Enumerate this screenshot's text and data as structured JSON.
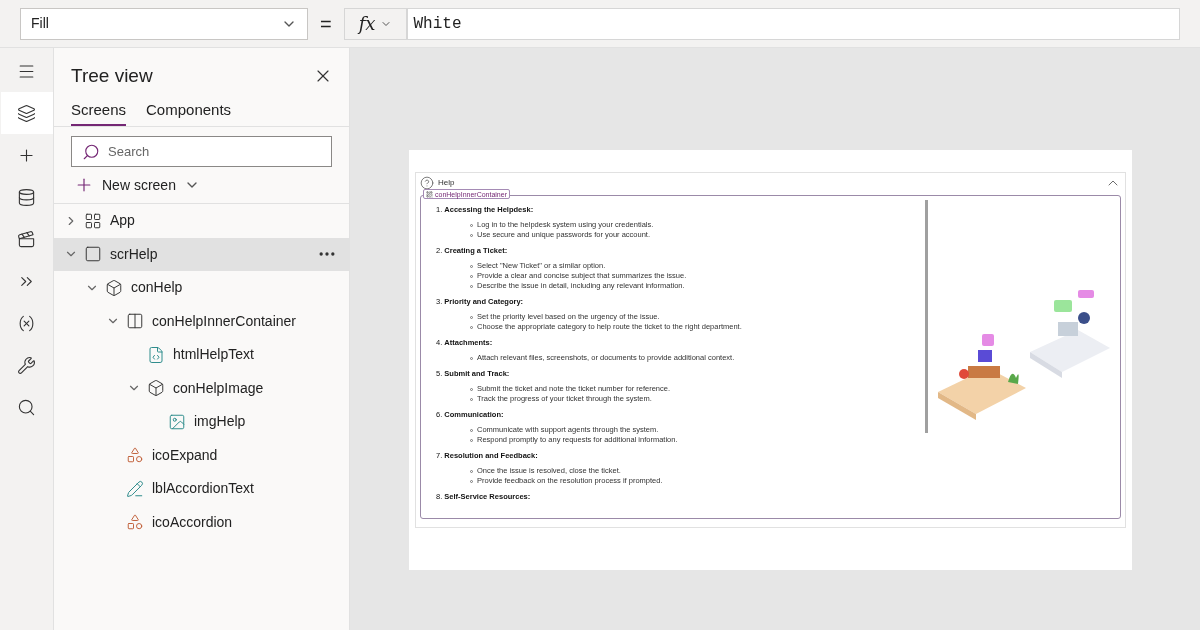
{
  "formula_bar": {
    "property": "Fill",
    "operator": "=",
    "fx_label": "fx",
    "value": "White"
  },
  "rail": [
    {
      "selected": false
    },
    {
      "selected": true
    },
    {
      "selected": false
    },
    {
      "selected": false
    },
    {
      "selected": false
    },
    {
      "selected": false
    },
    {
      "selected": false
    },
    {
      "selected": false
    },
    {
      "selected": false
    }
  ],
  "tree_view": {
    "title": "Tree view",
    "tabs": [
      {
        "label": "Screens",
        "selected": true
      },
      {
        "label": "Components",
        "selected": false
      }
    ],
    "search": {
      "placeholder": "Search"
    },
    "new_screen": "New screen",
    "items": [
      {
        "label": "App",
        "kind": "app",
        "expanded": false,
        "selected": false
      },
      {
        "label": "scrHelp",
        "kind": "screen",
        "expanded": true,
        "selected": true,
        "children": [
          {
            "label": "conHelp",
            "kind": "container",
            "expanded": true,
            "selected": false,
            "children": [
              {
                "label": "conHelpInnerContainer",
                "kind": "columns",
                "expanded": true,
                "selected": false,
                "children": [
                  {
                    "label": "htmlHelpText",
                    "kind": "html",
                    "selected": false
                  },
                  {
                    "label": "conHelpImage",
                    "kind": "container",
                    "expanded": true,
                    "selected": false,
                    "children": [
                      {
                        "label": "imgHelp",
                        "kind": "image",
                        "selected": false
                      }
                    ]
                  }
                ]
              },
              {
                "label": "icoExpand",
                "kind": "icon",
                "selected": false
              },
              {
                "label": "lblAccordionText",
                "kind": "label",
                "selected": false
              },
              {
                "label": "icoAccordion",
                "kind": "icon",
                "selected": false
              }
            ]
          }
        ]
      }
    ]
  },
  "canvas": {
    "header": "Help",
    "container_tag": "conHelpInnerContainer",
    "sections": [
      {
        "title": "1. **Accessing the Helpdesk:**",
        "bullets": [
          "Log in to the helpdesk system using your credentials.",
          "Use secure and unique passwords for your account."
        ]
      },
      {
        "title": "2. **Creating a Ticket:**",
        "bullets": [
          "Select \"New Ticket\" or a similar option.",
          "Provide a clear and concise subject that summarizes the issue.",
          "Describe the issue in detail, including any relevant information."
        ]
      },
      {
        "title": "3. **Priority and Category:**",
        "bullets": [
          "Set the priority level based on the urgency of the issue.",
          "Choose the appropriate category to help route the ticket to the right department."
        ]
      },
      {
        "title": "4. **Attachments:**",
        "bullets": [
          "Attach relevant files, screenshots, or documents to provide additional context."
        ]
      },
      {
        "title": "5. **Submit and Track:**",
        "bullets": [
          "Submit the ticket and note the ticket number for reference.",
          "Track the progress of your ticket through the system."
        ]
      },
      {
        "title": "6. **Communication:**",
        "bullets": [
          "Communicate with support agents through the system.",
          "Respond promptly to any requests for additional information."
        ]
      },
      {
        "title": "7. **Resolution and Feedback:**",
        "bullets": [
          "Once the issue is resolved, close the ticket.",
          "Provide feedback on the resolution process if prompted."
        ]
      },
      {
        "title": "8. **Self-Service Resources:**"
      }
    ]
  }
}
